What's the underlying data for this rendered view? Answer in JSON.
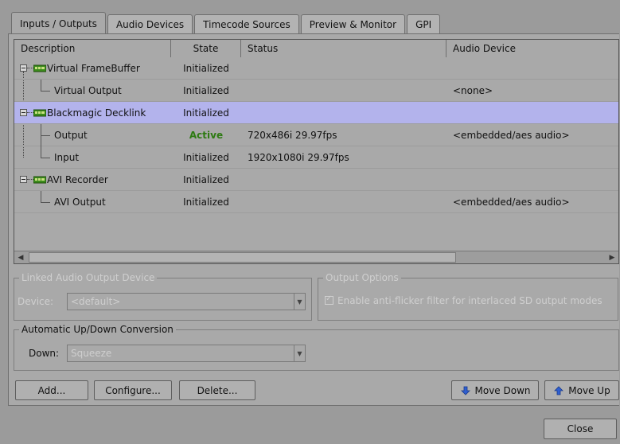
{
  "tabs": [
    "Inputs / Outputs",
    "Audio Devices",
    "Timecode Sources",
    "Preview & Monitor",
    "GPI"
  ],
  "table": {
    "headers": {
      "description": "Description",
      "state": "State",
      "status": "Status",
      "audio": "Audio Device"
    },
    "rows": [
      {
        "description": "Virtual FrameBuffer",
        "state": "Initialized",
        "status": "",
        "audio": ""
      },
      {
        "description": "Virtual Output",
        "state": "Initialized",
        "status": "",
        "audio": "<none>"
      },
      {
        "description": "Blackmagic Decklink",
        "state": "Initialized",
        "status": "",
        "audio": ""
      },
      {
        "description": "Output",
        "state": "Active",
        "status": "720x486i 29.97fps",
        "audio": "<embedded/aes audio>"
      },
      {
        "description": "Input",
        "state": "Initialized",
        "status": "1920x1080i 29.97fps",
        "audio": ""
      },
      {
        "description": "AVI Recorder",
        "state": "Initialized",
        "status": "",
        "audio": ""
      },
      {
        "description": "AVI Output",
        "state": "Initialized",
        "status": "",
        "audio": "<embedded/aes audio>"
      }
    ]
  },
  "linked_audio": {
    "title": "Linked Audio Output Device",
    "device_label": "Device:",
    "device_value": "<default>"
  },
  "output_options": {
    "title": "Output Options",
    "checkbox_label": "Enable anti-flicker filter for interlaced SD output modes"
  },
  "conversion": {
    "title": "Automatic Up/Down Conversion",
    "down_label": "Down:",
    "down_value": "Squeeze"
  },
  "buttons": {
    "add": "Add...",
    "configure": "Configure...",
    "delete": "Delete...",
    "move_down": "Move Down",
    "move_up": "Move Up",
    "close": "Close"
  },
  "colors": {
    "selected_row": "#b3b3ec",
    "active_state": "#2d7a12",
    "arrow_blue": "#2f5fd0",
    "card_green": "#3c8c1c"
  }
}
